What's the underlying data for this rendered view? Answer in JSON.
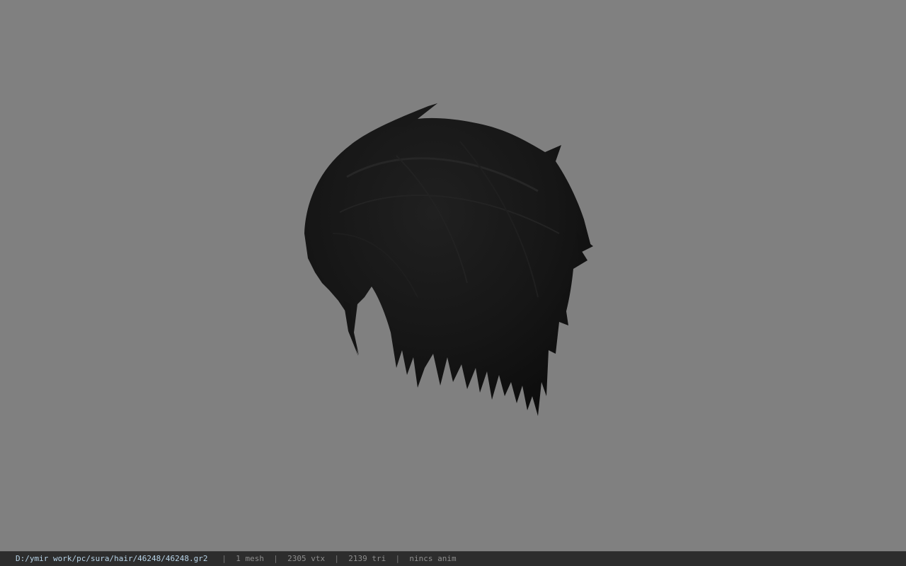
{
  "viewer": {
    "background_color": "#808080",
    "model_color": "#141414",
    "model_icon": "hair-mesh"
  },
  "status_bar": {
    "file_path": "D:/ymir work/pc/sura/hair/46248/46248.gr2",
    "separator": "|",
    "mesh_count": "1 mesh",
    "vertex_count": "2305 vtx",
    "triangle_count": "2139 tri",
    "animation": "nincs anim"
  }
}
